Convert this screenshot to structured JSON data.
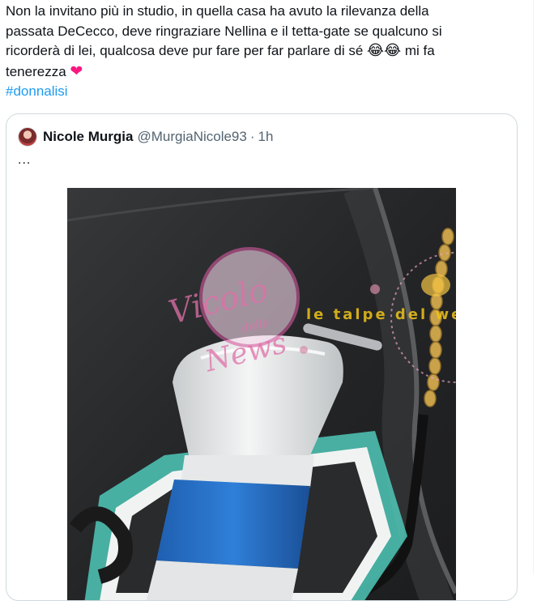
{
  "tweet": {
    "text_lines": [
      "Non la invitano più in studio, in quella casa ha avuto la rilevanza della",
      "passata DeCecco, deve ringraziare Nellina e il tetta-gate se qualcuno si",
      "ricorderà di lei, qualcosa deve pur fare per far parlare di sé",
      "mi fa",
      "tenerezza"
    ],
    "emojis": "😂😂",
    "heart": "❤",
    "hashtag": "#donnalisi"
  },
  "quoted_tweet": {
    "author_name": "Nicole Murgia",
    "author_handle": "@MurgiaNicole93",
    "separator": "·",
    "time": "1h",
    "text": "..."
  },
  "media": {
    "description_icon": "megaphone-photo",
    "watermark_1": {
      "text": "Vicolo delle News",
      "line1": "Vicolo",
      "line2": "delle",
      "line3": "News"
    },
    "watermark_2": {
      "text": "le talpe del web"
    }
  },
  "colors": {
    "hashtag": "#1d9bf0",
    "heart": "#f91880",
    "secondary_text": "#536471",
    "card_border": "#cfd9de"
  }
}
